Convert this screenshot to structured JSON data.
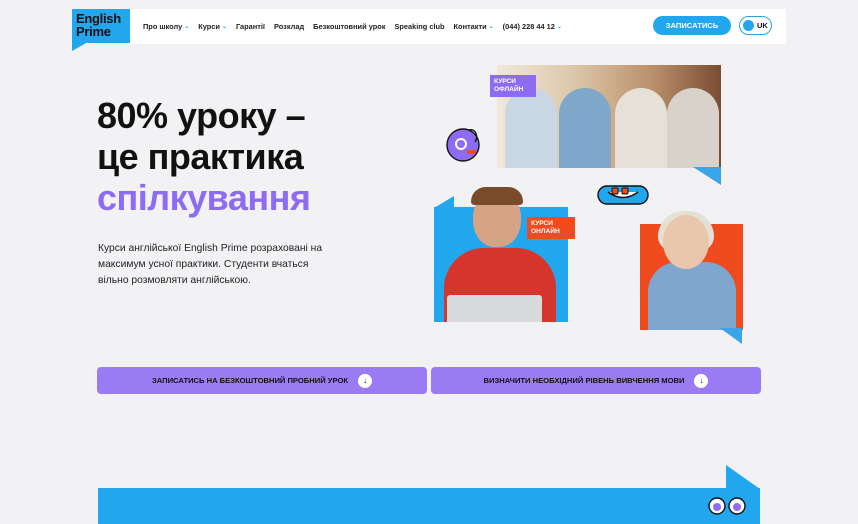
{
  "logo": {
    "text": "English\nPrime"
  },
  "nav": {
    "items": [
      {
        "label": "Про школу",
        "chevron": true
      },
      {
        "label": "Курси",
        "chevron": true
      },
      {
        "label": "Гарантії",
        "chevron": false
      },
      {
        "label": "Розклад",
        "chevron": false
      },
      {
        "label": "Безкоштовний урок",
        "chevron": false
      },
      {
        "label": "Speaking club",
        "chevron": false
      },
      {
        "label": "Контакти",
        "chevron": true
      },
      {
        "label": "(044) 228 44 12",
        "chevron": true
      }
    ],
    "cta": "ЗАПИСАТИСЬ",
    "lang": "UK"
  },
  "hero": {
    "line1": "80% уроку –",
    "line2": "це практика",
    "line3": "спілкування",
    "lead": "Курси англійської English Prime розраховані на максимум усної практики. Студенти вчаться вільно розмовляти англійською."
  },
  "tags": {
    "offline": "КУРСИ\nОФЛАЙН",
    "online": "КУРСИ\nОНЛАЙН"
  },
  "buttons": {
    "trial": "ЗАПИСАТИСЬ НА БЕЗКОШТОВНИЙ ПРОБНИЙ УРОК",
    "level": "ВИЗНАЧИТИ НЕОБХІДНИЙ РІВЕНЬ ВИВЧЕННЯ МОВИ"
  },
  "colors": {
    "blue": "#22a6ee",
    "purple": "#8d6bf2",
    "orange": "#f04a1f"
  }
}
